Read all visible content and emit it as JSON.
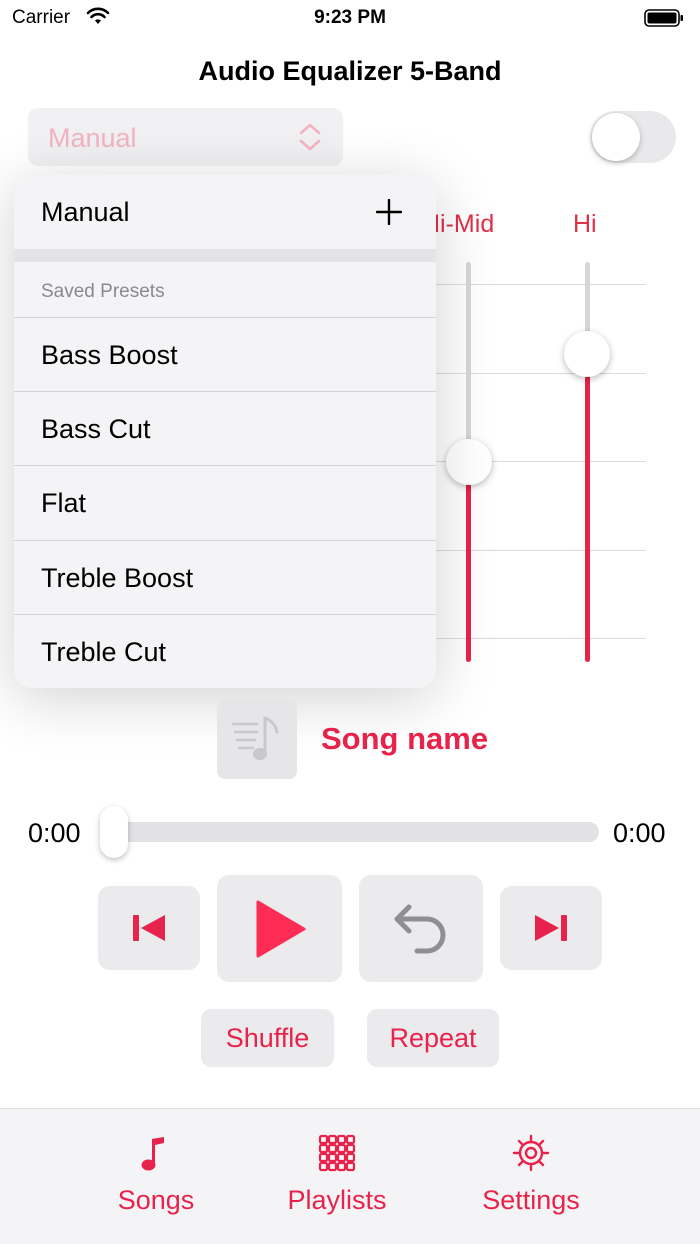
{
  "status_bar": {
    "carrier": "Carrier",
    "time": "9:23 PM"
  },
  "nav": {
    "title": "Audio Equalizer 5-Band"
  },
  "preset_picker": {
    "value": "Manual",
    "enabled": false
  },
  "eq_toggle": {
    "on": false
  },
  "bands": [
    {
      "label": "Hi-Mid",
      "level": 0.5
    },
    {
      "label": "Hi",
      "level": 0.77
    }
  ],
  "preset_menu": {
    "manual_label": "Manual",
    "section_title": "Saved Presets",
    "items": [
      "Bass Boost",
      "Bass Cut",
      "Flat",
      "Treble Boost",
      "Treble Cut"
    ]
  },
  "now_playing": {
    "song_name": "Song name"
  },
  "playback": {
    "elapsed": "0:00",
    "duration": "0:00",
    "progress": 0
  },
  "controls": {
    "shuffle_label": "Shuffle",
    "repeat_label": "Repeat"
  },
  "tabs": [
    {
      "label": "Songs",
      "icon": "music-note-icon"
    },
    {
      "label": "Playlists",
      "icon": "grid-icon"
    },
    {
      "label": "Settings",
      "icon": "gear-icon"
    }
  ],
  "colors": {
    "accent": "#e8234b",
    "band_label": "#e03048",
    "disabled_text": "#f3b3c1"
  }
}
